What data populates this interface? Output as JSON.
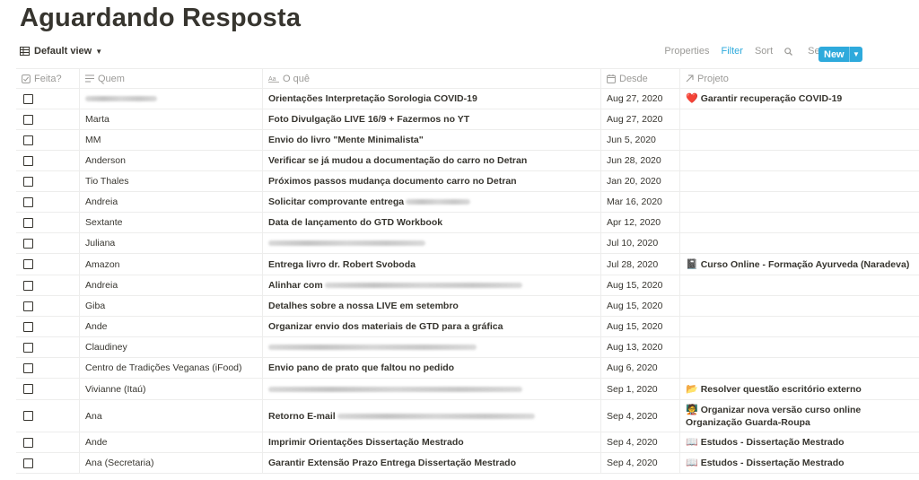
{
  "page": {
    "title": "Aguardando Resposta"
  },
  "toolbar": {
    "view_label": "Default view",
    "properties": "Properties",
    "filter": "Filter",
    "sort": "Sort",
    "search": "Search",
    "more": "···",
    "new": "New"
  },
  "columns": {
    "done": "Feita?",
    "who": "Quem",
    "what": "O quê",
    "since": "Desde",
    "project": "Projeto"
  },
  "rows": [
    {
      "who": "",
      "who_redacted": true,
      "what": "Orientações Interpretação Sorologia COVID-19",
      "since": "Aug 27, 2020",
      "project": "Garantir recuperação COVID-19",
      "project_icon": "❤️"
    },
    {
      "who": "Marta",
      "what": "Foto Divulgação LIVE 16/9 + Fazermos no YT",
      "since": "Aug 27, 2020",
      "project": ""
    },
    {
      "who": "MM",
      "what": "Envio do livro \"Mente Minimalista\"",
      "since": "Jun 5, 2020",
      "project": ""
    },
    {
      "who": "Anderson",
      "what": "Verificar se já mudou a documentação do carro no Detran",
      "since": "Jun 28, 2020",
      "project": ""
    },
    {
      "who": "Tio Thales",
      "what": "Próximos passos mudança documento carro no Detran",
      "since": "Jan 20, 2020",
      "project": ""
    },
    {
      "who": "Andreia",
      "what": "Solicitar comprovante entrega",
      "what_redacted": true,
      "since": "Mar 16, 2020",
      "project": ""
    },
    {
      "who": "Sextante",
      "what": "Data de lançamento do GTD Workbook",
      "since": "Apr 12, 2020",
      "project": ""
    },
    {
      "who": "Juliana",
      "what": "",
      "what_redacted": true,
      "since": "Jul 10, 2020",
      "project": ""
    },
    {
      "who": "Amazon",
      "what": "Entrega livro dr. Robert Svoboda",
      "since": "Jul 28, 2020",
      "project": "Curso Online - Formação Ayurveda (Naradeva)",
      "project_icon": "📓"
    },
    {
      "who": "Andreia",
      "what": "Alinhar com",
      "what_redacted": true,
      "since": "Aug 15, 2020",
      "project": ""
    },
    {
      "who": "Giba",
      "what": "Detalhes sobre a nossa LIVE em setembro",
      "since": "Aug 15, 2020",
      "project": ""
    },
    {
      "who": "Ande",
      "what": "Organizar envio dos materiais de GTD para a gráfica",
      "since": "Aug 15, 2020",
      "project": ""
    },
    {
      "who": "Claudiney",
      "what": "",
      "what_redacted": true,
      "since": "Aug 13, 2020",
      "project": ""
    },
    {
      "who": "Centro de Tradições Veganas (iFood)",
      "what": "Envio pano de prato que faltou no pedido",
      "since": "Aug 6, 2020",
      "project": ""
    },
    {
      "who": "Vivianne (Itaú)",
      "what": "",
      "what_redacted": true,
      "since": "Sep 1, 2020",
      "project": "Resolver questão escritório externo",
      "project_icon": "📂"
    },
    {
      "who": "Ana",
      "what": "Retorno E-mail",
      "what_redacted": true,
      "since": "Sep 4, 2020",
      "project": "Organizar nova versão curso online Organização Guarda-Roupa",
      "project_icon": "🧑‍🏫"
    },
    {
      "who": "Ande",
      "what": "Imprimir Orientações Dissertação Mestrado",
      "since": "Sep 4, 2020",
      "project": "Estudos - Dissertação Mestrado",
      "project_icon": "📖"
    },
    {
      "who": "Ana (Secretaria)",
      "what": "Garantir Extensão Prazo Entrega Dissertação Mestrado",
      "since": "Sep 4, 2020",
      "project": "Estudos - Dissertação Mestrado",
      "project_icon": "📖"
    }
  ]
}
